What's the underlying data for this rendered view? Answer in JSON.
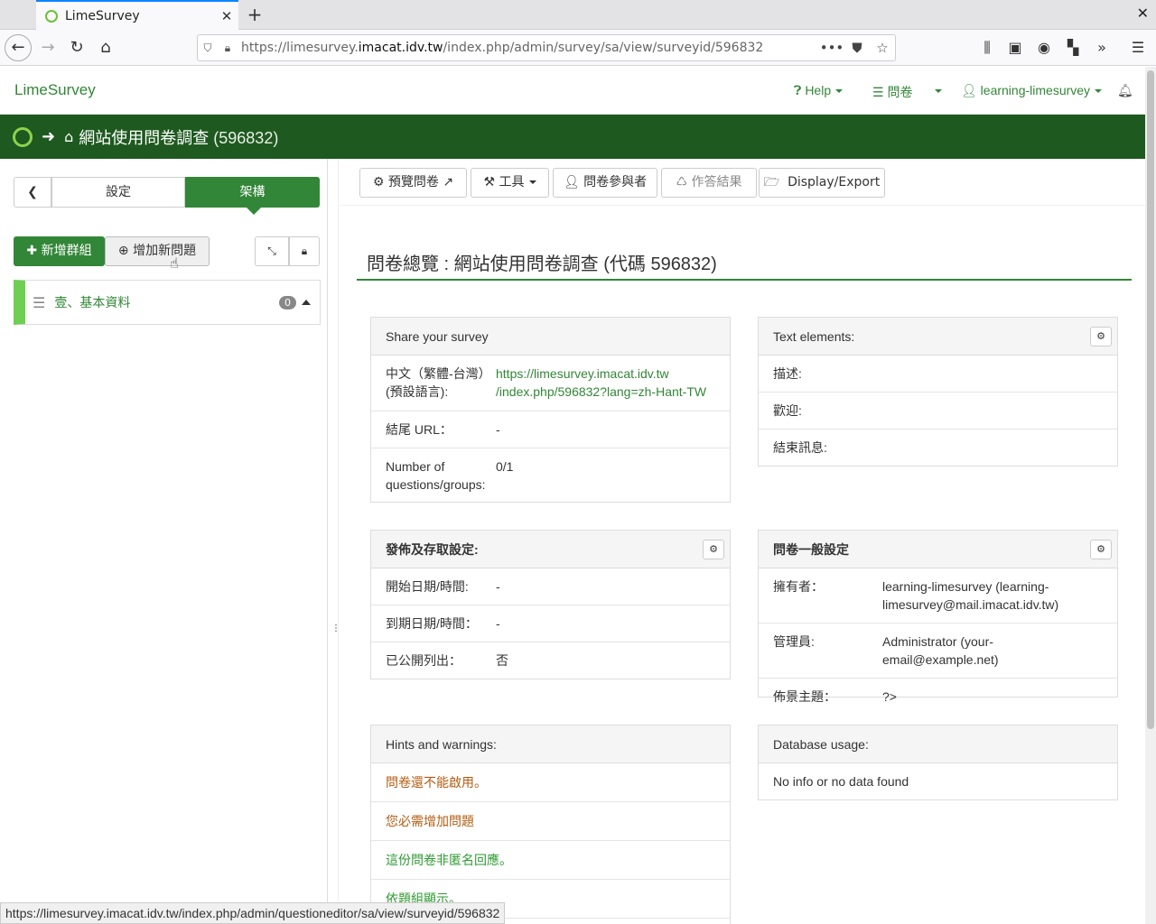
{
  "browser": {
    "tab_title": "LimeSurvey",
    "url_prefix": "https://limesurvey.",
    "url_domain": "imacat.idv.tw",
    "url_path": "/index.php/admin/survey/sa/view/surveyid/596832",
    "status_url": "https://limesurvey.imacat.idv.tw/index.php/admin/questioneditor/sa/view/surveyid/596832"
  },
  "topnav": {
    "brand": "LimeSurvey",
    "help": "Help",
    "surveys": "問卷",
    "user": "learning-limesurvey"
  },
  "breadcrumb": {
    "survey_title": "網站使用問卷調查",
    "survey_id": "(596832)"
  },
  "sidebar": {
    "tab_settings": "設定",
    "tab_structure": "架構",
    "add_group": "新增群組",
    "add_question": "增加新問題",
    "groups": [
      {
        "name": "壹、基本資料",
        "count": "0"
      }
    ]
  },
  "toolbar": {
    "preview": "預覽問卷",
    "tools": "工具",
    "participants": "問卷參與者",
    "responses": "作答結果",
    "display_export": "Display/Export"
  },
  "overview": {
    "title": "問卷總覽 : 網站使用問卷調查 (代碼 596832)"
  },
  "share": {
    "header": "Share your survey",
    "lang_label": "中文（繁體-台灣）(預設語言):",
    "link_line1": "https://limesurvey.imacat.idv.tw",
    "link_line2": "/index.php/596832?lang=zh-Hant-TW",
    "end_url_label": "結尾 URL：",
    "end_url_value": "-",
    "count_label": "Number of questions/groups:",
    "count_value": "0/1"
  },
  "text_elements": {
    "header": "Text elements:",
    "description": "描述:",
    "welcome": "歡迎:",
    "end_message": "結束訊息:"
  },
  "publication": {
    "header": "發佈及存取設定:",
    "start_label": "開始日期/時間:",
    "start_value": "-",
    "expiry_label": "到期日期/時間：",
    "expiry_value": "-",
    "public_label": "已公開列出：",
    "public_value": "否"
  },
  "general": {
    "header": "問卷一般設定",
    "owner_label": "擁有者：",
    "owner_value": "learning-limesurvey (learning-limesurvey@mail.imacat.idv.tw)",
    "admin_label": "管理員:",
    "admin_value": "Administrator (your-email@example.net)",
    "theme_label": "佈景主題：",
    "theme_value": "?>"
  },
  "hints": {
    "header": "Hints and warnings:",
    "items": [
      {
        "text": "問卷還不能啟用。",
        "color": "#b35c12"
      },
      {
        "text": "您必需增加問題",
        "color": "#b35c12"
      },
      {
        "text": "這份問卷非匿名回應。",
        "color": "#2e9a31"
      },
      {
        "text": "依題組顯示。",
        "color": "#2e9a31"
      }
    ]
  },
  "database": {
    "header": "Database usage:",
    "message": "No info or no data found"
  },
  "colors": {
    "brand_green": "#328637",
    "dark_green": "#1e5a1f"
  }
}
